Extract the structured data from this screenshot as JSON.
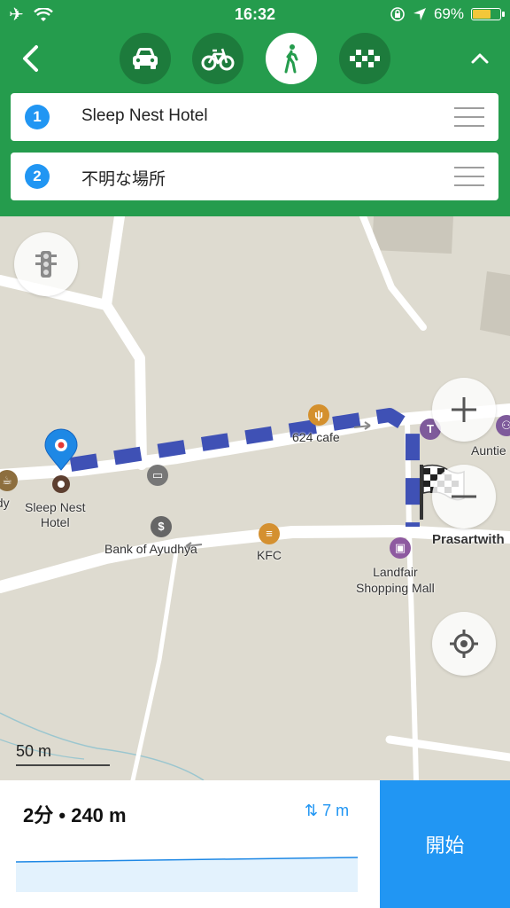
{
  "status_bar": {
    "time": "16:32",
    "battery_percent": "69%",
    "battery_level": 0.69
  },
  "header": {
    "transport_modes": [
      {
        "name": "car",
        "icon": "car-icon",
        "active": false
      },
      {
        "name": "bicycle",
        "icon": "bicycle-icon",
        "active": false
      },
      {
        "name": "walk",
        "icon": "walk-icon",
        "active": true
      },
      {
        "name": "taxi",
        "icon": "taxi-icon",
        "active": false
      }
    ],
    "waypoints": [
      {
        "number": "1",
        "label": "Sleep Nest Hotel"
      },
      {
        "number": "2",
        "label": "不明な場所"
      }
    ]
  },
  "map": {
    "labels": {
      "hotel": "Sleep Nest\nHotel",
      "bank": "Bank of Ayudhya",
      "kfc": "KFC",
      "cafe": "624 cafe",
      "mall": "Landfair\nShopping Mall",
      "prasart": "Prasartwith",
      "auntie": "Auntie",
      "andy": "ndy"
    },
    "scale": "50 m",
    "colors": {
      "route": "#3f51b5",
      "accent": "#259c4d"
    }
  },
  "route_summary": {
    "duration": "2分",
    "separator": "•",
    "distance": "240 m",
    "elevation": "7 m"
  },
  "start_button": {
    "label": "開始"
  }
}
